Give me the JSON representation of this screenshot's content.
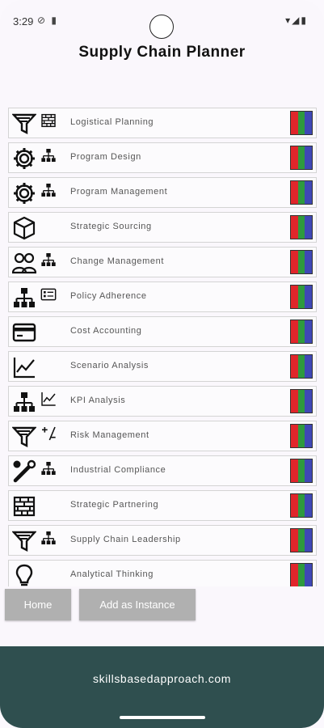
{
  "status_bar": {
    "time": "3:29",
    "left_icons": "⊘ ▮",
    "right_icons": "▾◢▮"
  },
  "app": {
    "title": "Supply Chain Planner"
  },
  "rows": [
    {
      "label": "Logistical Planning",
      "icon1": "funnel-icon",
      "icon2": "brick-wall-icon"
    },
    {
      "label": "Program Design",
      "icon1": "gear-icon",
      "icon2": "org-chart-icon"
    },
    {
      "label": "Program Management",
      "icon1": "gear-icon",
      "icon2": "org-chart-icon"
    },
    {
      "label": "Strategic Sourcing",
      "icon1": "cube-icon",
      "icon2": ""
    },
    {
      "label": "Change Management",
      "icon1": "people-icon",
      "icon2": "org-chart-icon"
    },
    {
      "label": "Policy Adherence",
      "icon1": "org-chart-icon",
      "icon2": "list-card-icon"
    },
    {
      "label": "Cost Accounting",
      "icon1": "credit-card-icon",
      "icon2": ""
    },
    {
      "label": "Scenario Analysis",
      "icon1": "line-chart-icon",
      "icon2": ""
    },
    {
      "label": "KPI Analysis",
      "icon1": "org-chart-icon",
      "icon2": "line-chart-icon"
    },
    {
      "label": "Risk Management",
      "icon1": "funnel-icon",
      "icon2": "plus-minus-icon"
    },
    {
      "label": "Industrial Compliance",
      "icon1": "tools-icon",
      "icon2": "org-chart-icon"
    },
    {
      "label": "Strategic Partnering",
      "icon1": "brick-wall-icon",
      "icon2": ""
    },
    {
      "label": "Supply Chain Leadership",
      "icon1": "funnel-icon",
      "icon2": "org-chart-icon"
    },
    {
      "label": "Analytical Thinking",
      "icon1": "lightbulb-icon",
      "icon2": ""
    }
  ],
  "flag_colors": [
    "#e0262b",
    "#2e9a3e",
    "#3f48b6"
  ],
  "buttons": {
    "home": "Home",
    "add_instance": "Add as Instance"
  },
  "footer": {
    "text": "skillsbasedapproach.com",
    "background": "#2f4f4f"
  }
}
